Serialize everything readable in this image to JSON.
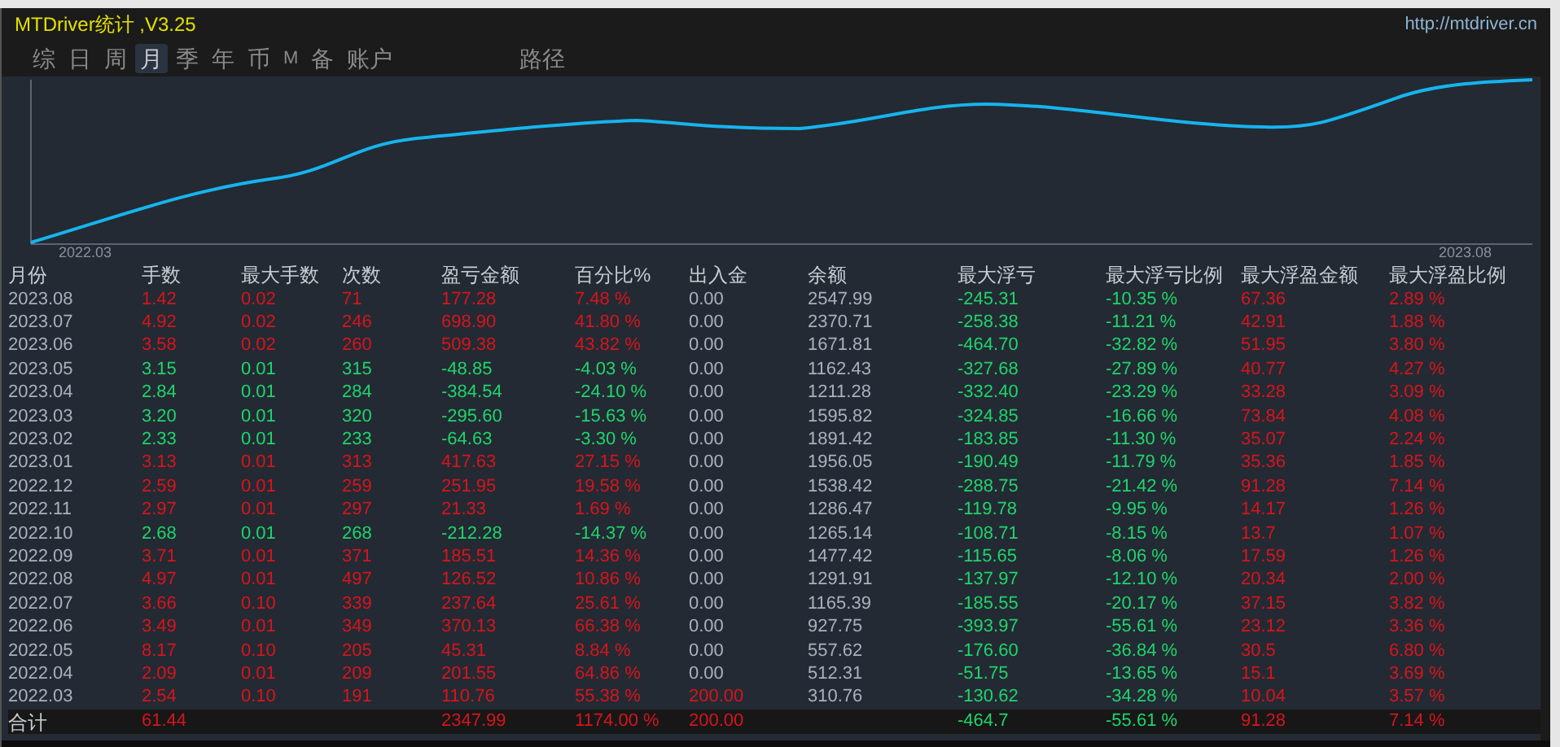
{
  "window": {
    "title": "MTDriver统计 ,V3.25",
    "link": "http://mtdriver.cn"
  },
  "tabs": [
    {
      "label": "综",
      "selected": false
    },
    {
      "label": "日",
      "selected": false
    },
    {
      "label": "周",
      "selected": false
    },
    {
      "label": "月",
      "selected": true
    },
    {
      "label": "季",
      "selected": false
    },
    {
      "label": "年",
      "selected": false
    },
    {
      "label": "币",
      "selected": false
    },
    {
      "label": "M",
      "selected": false
    },
    {
      "label": "备",
      "selected": false
    },
    {
      "label": "账户",
      "selected": false
    }
  ],
  "path_tab": {
    "label": "路径",
    "selected": false
  },
  "chart": {
    "start_label": "2022.03",
    "end_label": "2023.08"
  },
  "table": {
    "columns": [
      {
        "label": "月份",
        "kind": "neutral"
      },
      {
        "label": "手数",
        "kind": "trend"
      },
      {
        "label": "最大手数",
        "kind": "trend"
      },
      {
        "label": "次数",
        "kind": "trend"
      },
      {
        "label": "盈亏金额",
        "kind": "trend"
      },
      {
        "label": "百分比%",
        "kind": "trend"
      },
      {
        "label": "出入金",
        "kind": "flow"
      },
      {
        "label": "余额",
        "kind": "neutral"
      },
      {
        "label": "最大浮亏",
        "kind": "loss"
      },
      {
        "label": "最大浮亏比例",
        "kind": "loss"
      },
      {
        "label": "最大浮盈金额",
        "kind": "gain"
      },
      {
        "label": "最大浮盈比例",
        "kind": "gain"
      }
    ],
    "rows": [
      {
        "kind": "gain",
        "deposit": false,
        "cells": [
          "2023.08",
          "1.42",
          "0.02",
          "71",
          "177.28",
          "7.48 %",
          "0.00",
          "2547.99",
          "-245.31",
          "-10.35 %",
          "67.36",
          "2.89 %"
        ]
      },
      {
        "kind": "gain",
        "deposit": false,
        "cells": [
          "2023.07",
          "4.92",
          "0.02",
          "246",
          "698.90",
          "41.80 %",
          "0.00",
          "2370.71",
          "-258.38",
          "-11.21 %",
          "42.91",
          "1.88 %"
        ]
      },
      {
        "kind": "gain",
        "deposit": false,
        "cells": [
          "2023.06",
          "3.58",
          "0.02",
          "260",
          "509.38",
          "43.82 %",
          "0.00",
          "1671.81",
          "-464.70",
          "-32.82 %",
          "51.95",
          "3.80 %"
        ]
      },
      {
        "kind": "loss",
        "deposit": false,
        "cells": [
          "2023.05",
          "3.15",
          "0.01",
          "315",
          "-48.85",
          "-4.03 %",
          "0.00",
          "1162.43",
          "-327.68",
          "-27.89 %",
          "40.77",
          "4.27 %"
        ]
      },
      {
        "kind": "loss",
        "deposit": false,
        "cells": [
          "2023.04",
          "2.84",
          "0.01",
          "284",
          "-384.54",
          "-24.10 %",
          "0.00",
          "1211.28",
          "-332.40",
          "-23.29 %",
          "33.28",
          "3.09 %"
        ]
      },
      {
        "kind": "loss",
        "deposit": false,
        "cells": [
          "2023.03",
          "3.20",
          "0.01",
          "320",
          "-295.60",
          "-15.63 %",
          "0.00",
          "1595.82",
          "-324.85",
          "-16.66 %",
          "73.84",
          "4.08 %"
        ]
      },
      {
        "kind": "loss",
        "deposit": false,
        "cells": [
          "2023.02",
          "2.33",
          "0.01",
          "233",
          "-64.63",
          "-3.30 %",
          "0.00",
          "1891.42",
          "-183.85",
          "-11.30 %",
          "35.07",
          "2.24 %"
        ]
      },
      {
        "kind": "gain",
        "deposit": false,
        "cells": [
          "2023.01",
          "3.13",
          "0.01",
          "313",
          "417.63",
          "27.15 %",
          "0.00",
          "1956.05",
          "-190.49",
          "-11.79 %",
          "35.36",
          "1.85 %"
        ]
      },
      {
        "kind": "gain",
        "deposit": false,
        "cells": [
          "2022.12",
          "2.59",
          "0.01",
          "259",
          "251.95",
          "19.58 %",
          "0.00",
          "1538.42",
          "-288.75",
          "-21.42 %",
          "91.28",
          "7.14 %"
        ]
      },
      {
        "kind": "gain",
        "deposit": false,
        "cells": [
          "2022.11",
          "2.97",
          "0.01",
          "297",
          "21.33",
          "1.69 %",
          "0.00",
          "1286.47",
          "-119.78",
          "-9.95 %",
          "14.17",
          "1.26 %"
        ]
      },
      {
        "kind": "loss",
        "deposit": false,
        "cells": [
          "2022.10",
          "2.68",
          "0.01",
          "268",
          "-212.28",
          "-14.37 %",
          "0.00",
          "1265.14",
          "-108.71",
          "-8.15 %",
          "13.7",
          "1.07 %"
        ]
      },
      {
        "kind": "gain",
        "deposit": false,
        "cells": [
          "2022.09",
          "3.71",
          "0.01",
          "371",
          "185.51",
          "14.36 %",
          "0.00",
          "1477.42",
          "-115.65",
          "-8.06 %",
          "17.59",
          "1.26 %"
        ]
      },
      {
        "kind": "gain",
        "deposit": false,
        "cells": [
          "2022.08",
          "4.97",
          "0.01",
          "497",
          "126.52",
          "10.86 %",
          "0.00",
          "1291.91",
          "-137.97",
          "-12.10 %",
          "20.34",
          "2.00 %"
        ]
      },
      {
        "kind": "gain",
        "deposit": false,
        "cells": [
          "2022.07",
          "3.66",
          "0.10",
          "339",
          "237.64",
          "25.61 %",
          "0.00",
          "1165.39",
          "-185.55",
          "-20.17 %",
          "37.15",
          "3.82 %"
        ]
      },
      {
        "kind": "gain",
        "deposit": false,
        "cells": [
          "2022.06",
          "3.49",
          "0.01",
          "349",
          "370.13",
          "66.38 %",
          "0.00",
          "927.75",
          "-393.97",
          "-55.61 %",
          "23.12",
          "3.36 %"
        ]
      },
      {
        "kind": "gain",
        "deposit": false,
        "cells": [
          "2022.05",
          "8.17",
          "0.10",
          "205",
          "45.31",
          "8.84 %",
          "0.00",
          "557.62",
          "-176.60",
          "-36.84 %",
          "30.5",
          "6.80 %"
        ]
      },
      {
        "kind": "gain",
        "deposit": false,
        "cells": [
          "2022.04",
          "2.09",
          "0.01",
          "209",
          "201.55",
          "64.86 %",
          "0.00",
          "512.31",
          "-51.75",
          "-13.65 %",
          "15.1",
          "3.69 %"
        ]
      },
      {
        "kind": "gain",
        "deposit": true,
        "cells": [
          "2022.03",
          "2.54",
          "0.10",
          "191",
          "110.76",
          "55.38 %",
          "200.00",
          "310.76",
          "-130.62",
          "-34.28 %",
          "10.04",
          "3.57 %"
        ]
      }
    ],
    "total": {
      "kind": "gain",
      "deposit": true,
      "cells": [
        "合计",
        "61.44",
        null,
        null,
        "2347.99",
        "1174.00 %",
        "200.00",
        null,
        "-464.7",
        "-55.61 %",
        "91.28",
        "7.14 %"
      ]
    }
  }
}
